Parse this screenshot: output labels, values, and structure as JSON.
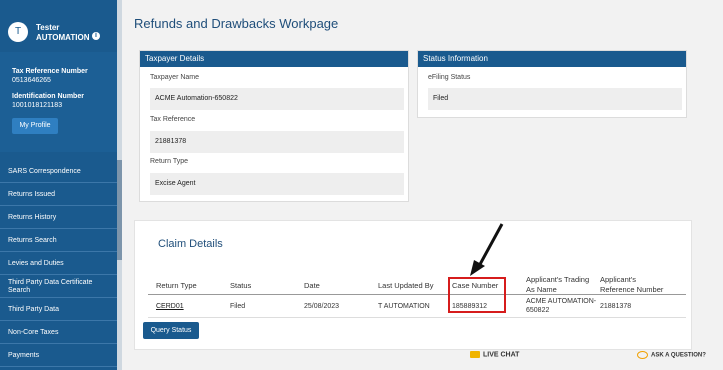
{
  "user": {
    "avatar_initial": "T",
    "first_name": "Tester",
    "last_name": "AUTOMATION",
    "info_icon": "i"
  },
  "profile": {
    "tax_ref_label": "Tax Reference Number",
    "tax_ref_value": "0513646265",
    "id_label": "Identification Number",
    "id_value": "1001018121183",
    "my_profile_button": "My Profile"
  },
  "nav": [
    "SARS Correspondence",
    "Returns Issued",
    "Returns History",
    "Returns Search",
    "Levies and Duties",
    "Third Party Data Certificate Search",
    "Third Party Data",
    "Non-Core Taxes",
    "Payments"
  ],
  "page_title": "Refunds and Drawbacks Workpage",
  "taxpayer_panel": {
    "title": "Taxpayer Details",
    "name_label": "Taxpayer Name",
    "name_value": "ACME Automation-650822",
    "tax_ref_label": "Tax Reference",
    "tax_ref_value": "21881378",
    "return_type_label": "Return Type",
    "return_type_value": "Excise Agent"
  },
  "status_panel": {
    "title": "Status Information",
    "efiling_label": "eFiling Status",
    "efiling_value": "Filed"
  },
  "claim": {
    "title": "Claim Details",
    "headers": {
      "return_type": "Return Type",
      "status": "Status",
      "date": "Date",
      "last_updated_by": "Last Updated By",
      "case_number": "Case Number",
      "trading_name_1": "Applicant's Trading",
      "trading_name_2": "As Name",
      "app_ref_1": "Applicant's",
      "app_ref_2": "Reference Number"
    },
    "row": {
      "return_type": "CERD01",
      "status": "Filed",
      "date": "25/08/2023",
      "last_updated_by": "T AUTOMATION",
      "case_number": "185889312",
      "trading_name_1": "ACME AUTOMATION-",
      "trading_name_2": "650822",
      "app_ref": "21881378"
    },
    "query_button": "Query Status"
  },
  "footer": {
    "live_chat": "LIVE CHAT",
    "ask_question": "ASK A QUESTION?"
  },
  "colors": {
    "brand": "#1a5a8e",
    "highlight": "#d61c1c"
  }
}
